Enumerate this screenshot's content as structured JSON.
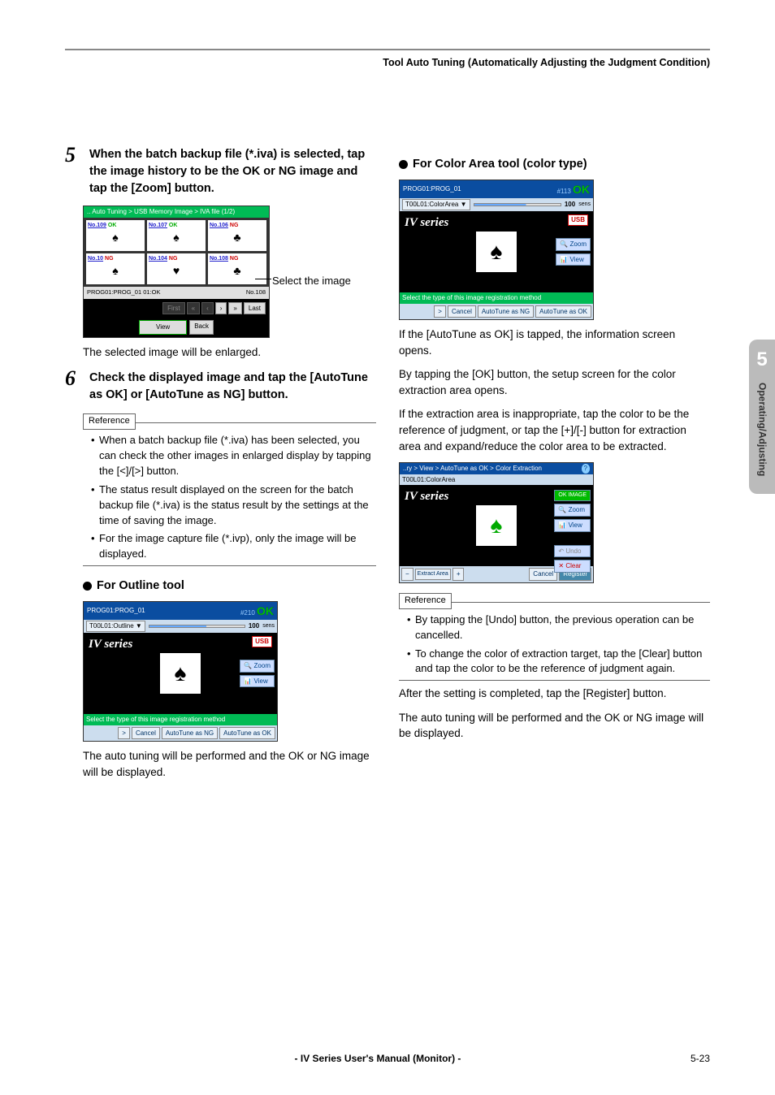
{
  "header": "Tool Auto Tuning (Automatically Adjusting the Judgment Condition)",
  "left": {
    "step5": {
      "num": "5",
      "text": "When the batch backup file (*.iva) is selected, tap the image history to be the OK or NG image and tap the [Zoom] button.",
      "screenshot": {
        "topbar": ".. Auto Tuning > USB Memory Image > IVA file       (1/2)",
        "tiles": [
          {
            "label": "No.109",
            "status": "OK"
          },
          {
            "label": "No.107",
            "status": "OK"
          },
          {
            "label": "No.106",
            "status": "NG"
          },
          {
            "label": "No.10",
            "status": "NG"
          },
          {
            "label": "No.104",
            "status": "NG"
          },
          {
            "label": "No.108",
            "status": "NG"
          }
        ],
        "status_left": "PROG01:PROG_01\n01:OK",
        "status_right": "No.108",
        "nav": {
          "first": "First",
          "view": "View",
          "back": "Back",
          "last": "Last"
        }
      },
      "callout": "Select the image",
      "after": "The selected image will be enlarged."
    },
    "step6": {
      "num": "6",
      "text": "Check the displayed image and tap the [AutoTune as OK] or [AutoTune as NG] button.",
      "ref_label": "Reference",
      "ref_items": [
        "When a batch backup file (*.iva) has been selected,  you can check the other images in enlarged display by tapping the [<]/[>] button.",
        "The status result displayed on the screen for the batch backup file (*.iva) is the status result by the settings at the time of saving the image.",
        "For the image capture file (*.ivp), only the image will be displayed."
      ]
    },
    "outline": {
      "title": "For Outline tool",
      "dev": {
        "prog": "PROG01:PROG_01",
        "score_hash": "#210",
        "ok": "OK",
        "tool": "T00L01:Outline  ▼",
        "val": "100",
        "mode": "sens",
        "usb": "USB",
        "zoom": "Zoom",
        "view": "View",
        "msg": "Select the type of this image registration method",
        "nav": ">",
        "cancel": "Cancel",
        "ng": "AutoTune as NG",
        "okbtn": "AutoTune as OK"
      },
      "after": "The auto tuning will be performed and the OK or NG image will be displayed."
    }
  },
  "right": {
    "color": {
      "title": "For Color Area tool (color type)",
      "dev": {
        "prog": "PROG01:PROG_01",
        "score_hash": "#113",
        "ok": "OK",
        "tool": "T00L01:ColorArea ▼",
        "val": "100",
        "mode": "sens",
        "usb": "USB",
        "zoom": "Zoom",
        "view": "View",
        "msg": "Select the type of this image registration method",
        "nav": ">",
        "cancel": "Cancel",
        "ng": "AutoTune as NG",
        "okbtn": "AutoTune as OK"
      },
      "para1": "If the [AutoTune as OK] is tapped, the information screen opens.",
      "para2": "By tapping the [OK] button, the setup screen for the color extraction area opens.",
      "para3": "If the extraction area is inappropriate, tap the color to be the reference of judgment, or tap the [+]/[-] button for extraction area and expand/reduce the color area to be extracted.",
      "dev2": {
        "crumb": "..ry > View > AutoTune as OK > Color Extraction",
        "sub": "T00L01:ColorArea",
        "okimg": "OK IMAGE",
        "zoom": "Zoom",
        "view": "View",
        "undo": "Undo",
        "clear": "Clear",
        "extract": "Extract Area",
        "cancel": "Cancel",
        "register": "Register"
      },
      "ref_label": "Reference",
      "ref_items": [
        "By tapping the [Undo] button, the previous operation can be cancelled.",
        "To change the color of extraction target, tap the [Clear] button and tap the color to be the reference of judgment again."
      ],
      "para4": "After the setting is completed, tap the [Register] button.",
      "para5": "The auto tuning will be performed and the OK or NG image will be displayed."
    }
  },
  "sidetab": {
    "num": "5",
    "label": "Operating/Adjusting"
  },
  "footer": {
    "center": "- IV Series User's Manual (Monitor) -",
    "right": "5-23"
  }
}
